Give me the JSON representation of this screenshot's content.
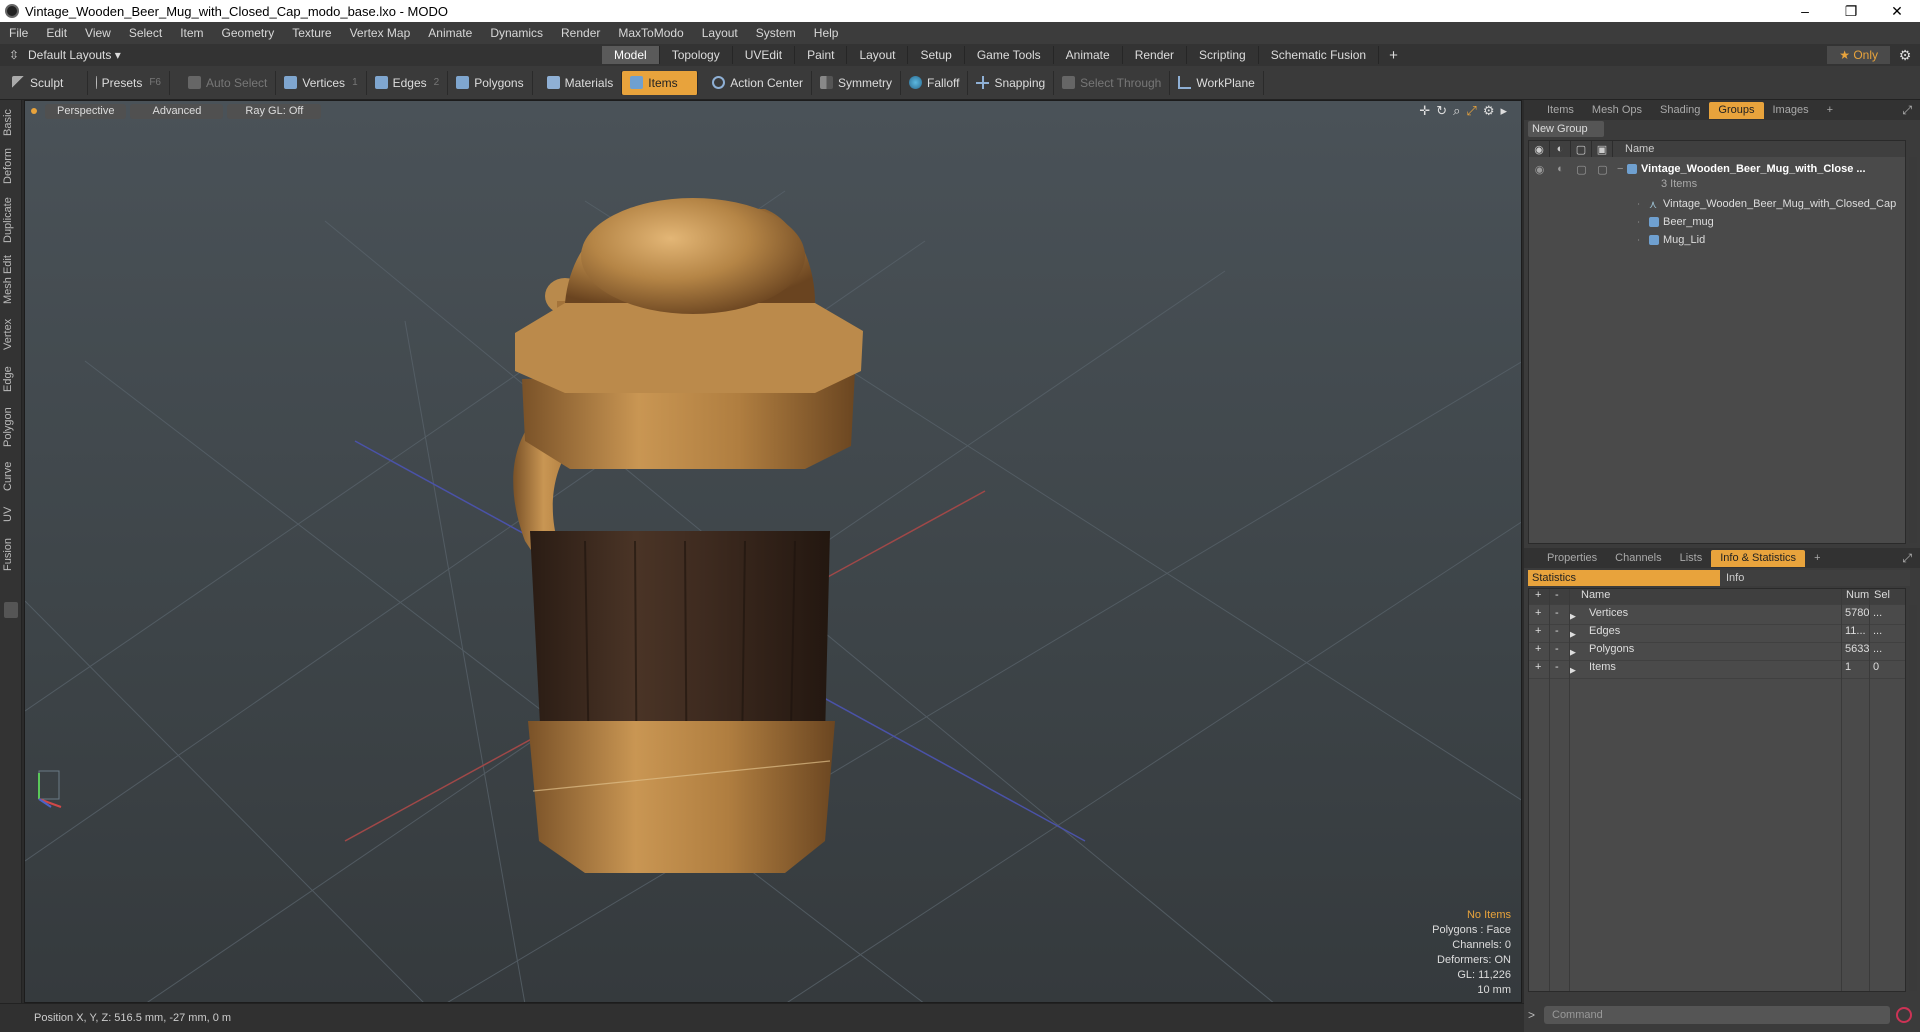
{
  "window": {
    "title": "Vintage_Wooden_Beer_Mug_with_Closed_Cap_modo_base.lxo - MODO",
    "minimize": "–",
    "maximize": "❐",
    "close": "✕"
  },
  "menu": [
    "File",
    "Edit",
    "View",
    "Select",
    "Item",
    "Geometry",
    "Texture",
    "Vertex Map",
    "Animate",
    "Dynamics",
    "Render",
    "MaxToModo",
    "Layout",
    "System",
    "Help"
  ],
  "layoutbar": {
    "layout_dropdown": "Default Layouts ▾",
    "tabs": [
      "Model",
      "Topology",
      "UVEdit",
      "Paint",
      "Layout",
      "Setup",
      "Game Tools",
      "Animate",
      "Render",
      "Scripting",
      "Schematic Fusion"
    ],
    "active_tab": "Model",
    "add": "+",
    "only": "★ Only",
    "gear": "⚙"
  },
  "toolbar": {
    "sculpt": "Sculpt",
    "presets": "Presets",
    "presets_key": "F6",
    "auto_select": "Auto Select",
    "vertices": "Vertices",
    "vertices_count": "1",
    "edges": "Edges",
    "edges_count": "2",
    "polygons": "Polygons",
    "materials": "Materials",
    "items": "Items",
    "action_center": "Action Center",
    "symmetry": "Symmetry",
    "falloff": "Falloff",
    "snapping": "Snapping",
    "select_through": "Select Through",
    "workplane": "WorkPlane"
  },
  "left_tabs": [
    "Basic",
    "Deform",
    "Duplicate",
    "Mesh Edit",
    "Vertex",
    "Edge",
    "Polygon",
    "Curve",
    "UV",
    "Fusion"
  ],
  "viewport": {
    "perspective": "Perspective",
    "advanced": "Advanced",
    "raygl": "Ray GL: Off",
    "info": {
      "no_items": "No Items",
      "polygons": "Polygons : Face",
      "channels": "Channels: 0",
      "deformers": "Deformers: ON",
      "gl": "GL: 11,226",
      "scale": "10 mm"
    }
  },
  "status": {
    "position": "Position X, Y, Z:   516.5 mm, -27 mm, 0 m"
  },
  "groups_panel": {
    "tabs": [
      "Items",
      "Mesh Ops",
      "Shading",
      "Groups",
      "Images"
    ],
    "active_tab": "Groups",
    "add": "+",
    "new_group": "New Group",
    "name_header": "Name",
    "root": "Vintage_Wooden_Beer_Mug_with_Close ...",
    "root_count": "3 Items",
    "children": [
      "Vintage_Wooden_Beer_Mug_with_Closed_Cap",
      "Beer_mug",
      "Mug_Lid"
    ]
  },
  "stats_panel": {
    "tabs": [
      "Properties",
      "Channels",
      "Lists",
      "Info & Statistics"
    ],
    "active_tab": "Info & Statistics",
    "add": "+",
    "sub_tabs": [
      "Statistics",
      "Info"
    ],
    "headers": {
      "name": "Name",
      "num": "Num",
      "sel": "Sel"
    },
    "rows": [
      {
        "name": "Vertices",
        "num": "5780",
        "sel": "..."
      },
      {
        "name": "Edges",
        "num": "11...",
        "sel": "..."
      },
      {
        "name": "Polygons",
        "num": "5633",
        "sel": "..."
      },
      {
        "name": "Items",
        "num": "1",
        "sel": "0"
      }
    ]
  },
  "command": {
    "placeholder": "Command",
    "prompt": ">"
  },
  "colors": {
    "accent": "#e8a33c",
    "viewport_top": "#4a5258",
    "viewport_bottom": "#353a3d"
  }
}
